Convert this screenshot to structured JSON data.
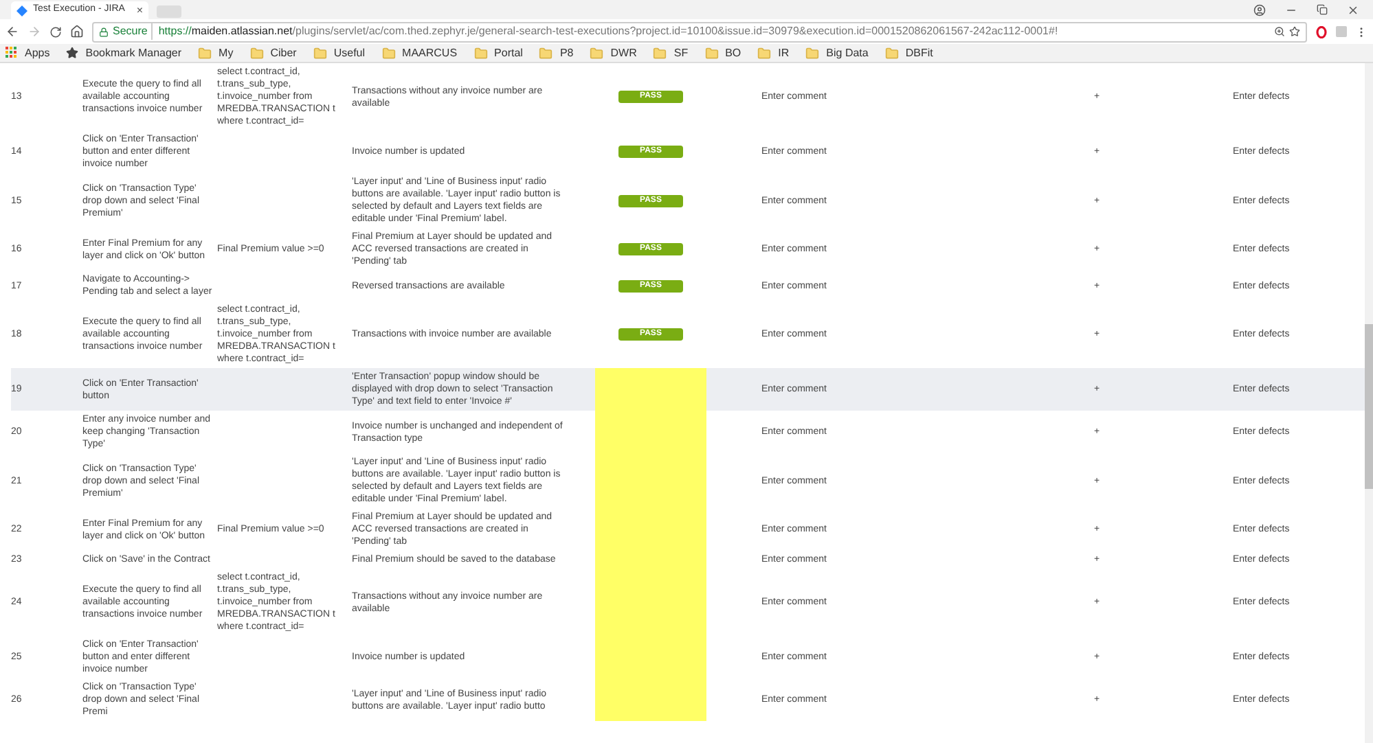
{
  "browser": {
    "tab_title": "Test Execution - JIRA",
    "tab_close": "×",
    "secure_label": "Secure",
    "url": {
      "scheme": "https://",
      "host": "maiden.atlassian.net",
      "path": "/plugins/servlet/ac/com.thed.zephyr.je/general-search-test-executions?project.id=10100&issue.id=30979&execution.id=0001520862061567-242ac112-0001#!"
    },
    "bookmarks": [
      {
        "kind": "apps",
        "label": "Apps"
      },
      {
        "kind": "star",
        "label": "Bookmark Manager"
      },
      {
        "kind": "folder",
        "label": "My"
      },
      {
        "kind": "folder",
        "label": "Ciber"
      },
      {
        "kind": "folder",
        "label": "Useful"
      },
      {
        "kind": "folder",
        "label": "MAARCUS"
      },
      {
        "kind": "folder",
        "label": "Portal"
      },
      {
        "kind": "folder",
        "label": "P8"
      },
      {
        "kind": "folder",
        "label": "DWR"
      },
      {
        "kind": "folder",
        "label": "SF"
      },
      {
        "kind": "folder",
        "label": "BO"
      },
      {
        "kind": "folder",
        "label": "IR"
      },
      {
        "kind": "folder",
        "label": "Big Data"
      },
      {
        "kind": "folder",
        "label": "DBFit"
      }
    ]
  },
  "table": {
    "rows": [
      {
        "number": "13",
        "step": "Execute the query to find all available accounting transactions invoice number",
        "test_data": "select t.contract_id, t.trans_sub_type, t.invoice_number from MREDBA.TRANSACTION t where t.contract_id=",
        "expected": "Transactions without any invoice number are available",
        "status": {
          "kind": "pass",
          "label": "PASS"
        },
        "comment": "Enter comment",
        "attach": "+",
        "defects": "Enter defects",
        "highlighted": false
      },
      {
        "number": "14",
        "step": "Click on 'Enter Transaction' button and enter different invoice number",
        "expected": "Invoice number is updated",
        "status": {
          "kind": "pass",
          "label": "PASS"
        },
        "comment": "Enter comment",
        "attach": "+",
        "defects": "Enter defects",
        "highlighted": false
      },
      {
        "number": "15",
        "step": "Click on 'Transaction Type' drop down and select 'Final Premium'",
        "expected": "'Layer input' and 'Line of Business input' radio buttons are available. 'Layer input' radio button is selected by default and Layers text fields are editable under 'Final Premium' label.",
        "status": {
          "kind": "pass",
          "label": "PASS"
        },
        "comment": "Enter comment",
        "attach": "+",
        "defects": "Enter defects",
        "highlighted": false
      },
      {
        "number": "16",
        "step": "Enter Final Premium for any layer and click on 'Ok' button",
        "test_data": "Final Premium value >=0",
        "expected": "Final Premium at Layer should be updated and ACC reversed transactions are created in 'Pending' tab",
        "status": {
          "kind": "pass",
          "label": "PASS"
        },
        "comment": "Enter comment",
        "attach": "+",
        "defects": "Enter defects",
        "highlighted": false
      },
      {
        "number": "17",
        "step": "Navigate to Accounting-> Pending tab and select a layer",
        "expected": "Reversed transactions are available",
        "status": {
          "kind": "pass",
          "label": "PASS"
        },
        "comment": "Enter comment",
        "attach": "+",
        "defects": "Enter defects",
        "highlighted": false
      },
      {
        "number": "18",
        "step": "Execute the query to find all available accounting transactions invoice number",
        "test_data": "select t.contract_id, t.trans_sub_type, t.invoice_number from MREDBA.TRANSACTION t where t.contract_id=",
        "expected": "Transactions with invoice number are available",
        "status": {
          "kind": "pass",
          "label": "PASS"
        },
        "comment": "Enter comment",
        "attach": "+",
        "defects": "Enter defects",
        "highlighted": false
      },
      {
        "number": "19",
        "step": "Click on 'Enter Transaction' button",
        "expected": "'Enter Transaction' popup window should be displayed with drop down to select 'Transaction Type' and text field to enter 'Invoice #'",
        "status": {
          "kind": "unexecuted"
        },
        "comment": "Enter comment",
        "attach": "+",
        "defects": "Enter defects",
        "highlighted": true
      },
      {
        "number": "20",
        "step": "Enter any invoice number and keep changing 'Transaction Type'",
        "expected": "Invoice number is unchanged and independent of Transaction type",
        "status": {
          "kind": "unexecuted"
        },
        "comment": "Enter comment",
        "attach": "+",
        "defects": "Enter defects",
        "highlighted": false
      },
      {
        "number": "21",
        "step": "Click on 'Transaction Type' drop down and select 'Final Premium'",
        "expected": "'Layer input' and 'Line of Business input' radio buttons are available. 'Layer input' radio button is selected by default and Layers text fields are editable under 'Final Premium' label.",
        "status": {
          "kind": "unexecuted"
        },
        "comment": "Enter comment",
        "attach": "+",
        "defects": "Enter defects",
        "highlighted": false
      },
      {
        "number": "22",
        "step": "Enter Final Premium for any layer and click on 'Ok' button",
        "test_data": "Final Premium value >=0",
        "expected": "Final Premium at Layer should be updated and ACC reversed transactions are created in 'Pending' tab",
        "status": {
          "kind": "unexecuted"
        },
        "comment": "Enter comment",
        "attach": "+",
        "defects": "Enter defects",
        "highlighted": false
      },
      {
        "number": "23",
        "step": "Click on 'Save' in the Contract",
        "expected": "Final Premium should be saved to the database",
        "status": {
          "kind": "unexecuted"
        },
        "comment": "Enter comment",
        "attach": "+",
        "defects": "Enter defects",
        "highlighted": false
      },
      {
        "number": "24",
        "step": "Execute the query to find all available accounting transactions invoice number",
        "test_data": "select t.contract_id, t.trans_sub_type, t.invoice_number from MREDBA.TRANSACTION t where t.contract_id=",
        "expected": "Transactions without any invoice number are available",
        "status": {
          "kind": "unexecuted"
        },
        "comment": "Enter comment",
        "attach": "+",
        "defects": "Enter defects",
        "highlighted": false
      },
      {
        "number": "25",
        "step": "Click on 'Enter Transaction' button and enter different invoice number",
        "expected": "Invoice number is updated",
        "status": {
          "kind": "unexecuted"
        },
        "comment": "Enter comment",
        "attach": "+",
        "defects": "Enter defects",
        "highlighted": false
      },
      {
        "number": "26",
        "step": "Click on 'Transaction Type' drop down and select 'Final Premi",
        "expected": "'Layer input' and 'Line of Business input' radio buttons are available. 'Layer input' radio butto",
        "status": {
          "kind": "unexecuted"
        },
        "comment": "Enter comment",
        "attach": "+",
        "defects": "Enter defects",
        "highlighted": false
      }
    ]
  }
}
